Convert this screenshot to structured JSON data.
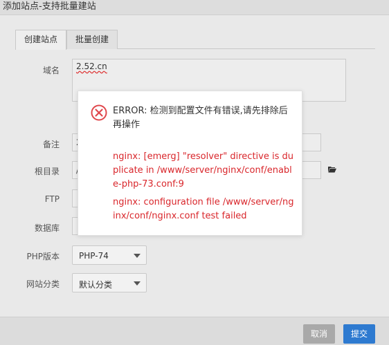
{
  "dialog": {
    "title": "添加站点-支持批量建站"
  },
  "tabs": [
    {
      "label": "创建站点",
      "active": true
    },
    {
      "label": "批量创建",
      "active": false
    }
  ],
  "form": {
    "domain_label": "域名",
    "domain_value": "2.52.cn",
    "remark_label": "备注",
    "remark_value": "2",
    "root_label": "根目录",
    "root_value": "/",
    "ftp_label": "FTP",
    "db_label": "数据库",
    "php_label": "PHP版本",
    "php_value": "PHP-74",
    "category_label": "网站分类",
    "category_value": "默认分类"
  },
  "footer": {
    "cancel_label": "取消",
    "submit_label": "提交"
  },
  "error": {
    "heading": "ERROR: 检测到配置文件有错误,请先排除后再操作",
    "line1": "nginx: [emerg] \"resolver\" directive is duplicate in /www/server/nginx/conf/enable-php-73.conf:9",
    "line2": "nginx: configuration file /www/server/nginx/conf/nginx.conf test failed",
    "icon": "error-circle-icon",
    "color": "#d9262b"
  },
  "colors": {
    "submit": "#2e7ad0",
    "cancel": "#a9a9a9",
    "error_text": "#d9262b"
  }
}
